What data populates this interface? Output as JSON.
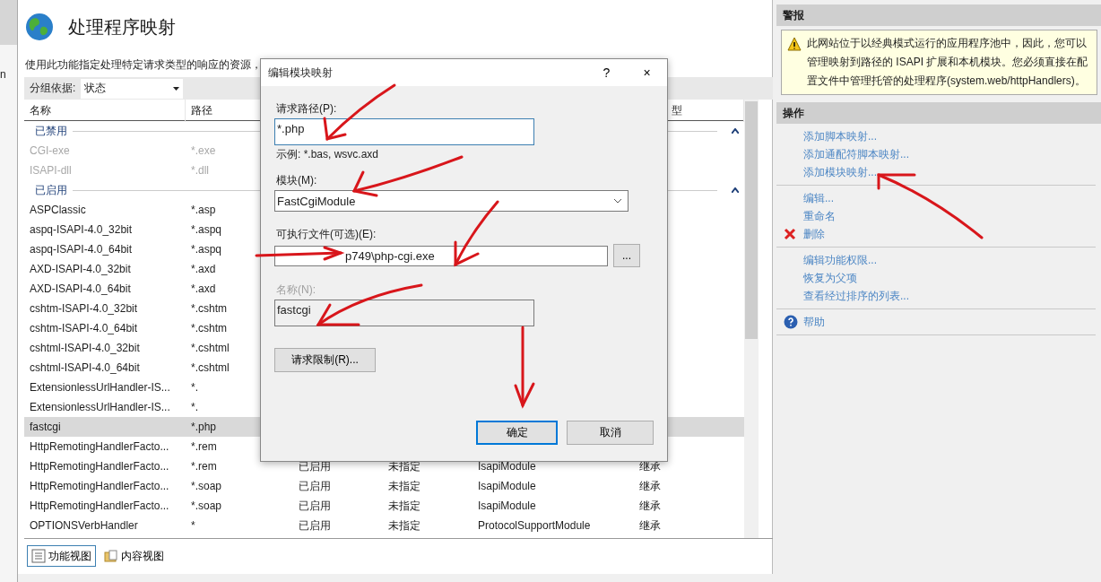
{
  "sidebar_fragment": "n",
  "page": {
    "title": "处理程序映射",
    "description": "使用此功能指定处理特定请求类型的响应的资源，"
  },
  "group_by": {
    "label": "分组依据:",
    "value": "状态"
  },
  "table": {
    "header": {
      "name": "名称",
      "path": "路径",
      "column_6": "型"
    },
    "groups": [
      {
        "label": "已禁用",
        "expanded": true,
        "rows": [
          {
            "name": "CGI-exe",
            "path": "*.exe",
            "disabled": true,
            "selected": false
          },
          {
            "name": "ISAPI-dll",
            "path": "*.dll",
            "disabled": true,
            "selected": false
          }
        ]
      },
      {
        "label": "已启用",
        "expanded": true,
        "rows": [
          {
            "name": "ASPClassic",
            "path": "*.asp",
            "disabled": false,
            "selected": false
          },
          {
            "name": "aspq-ISAPI-4.0_32bit",
            "path": "*.aspq",
            "disabled": false,
            "selected": false
          },
          {
            "name": "aspq-ISAPI-4.0_64bit",
            "path": "*.aspq",
            "disabled": false,
            "selected": false
          },
          {
            "name": "AXD-ISAPI-4.0_32bit",
            "path": "*.axd",
            "disabled": false,
            "selected": false
          },
          {
            "name": "AXD-ISAPI-4.0_64bit",
            "path": "*.axd",
            "disabled": false,
            "selected": false
          },
          {
            "name": "cshtm-ISAPI-4.0_32bit",
            "path": "*.cshtm",
            "disabled": false,
            "selected": false
          },
          {
            "name": "cshtm-ISAPI-4.0_64bit",
            "path": "*.cshtm",
            "disabled": false,
            "selected": false
          },
          {
            "name": "cshtml-ISAPI-4.0_32bit",
            "path": "*.cshtml",
            "disabled": false,
            "selected": false
          },
          {
            "name": "cshtml-ISAPI-4.0_64bit",
            "path": "*.cshtml",
            "disabled": false,
            "selected": false
          },
          {
            "name": "ExtensionlessUrlHandler-IS...",
            "path": "*.",
            "disabled": false,
            "selected": false
          },
          {
            "name": "ExtensionlessUrlHandler-IS...",
            "path": "*.",
            "disabled": false,
            "selected": false
          },
          {
            "name": "fastcgi",
            "path": "*.php",
            "disabled": false,
            "selected": true
          },
          {
            "name": "HttpRemotingHandlerFacto...",
            "path": "*.rem",
            "disabled": false,
            "selected": false
          },
          {
            "name": "HttpRemotingHandlerFacto...",
            "path": "*.rem",
            "column_3": "已启用",
            "column_4": "未指定",
            "column_5": "IsapiModule",
            "column_6": "继承",
            "disabled": false,
            "selected": false
          },
          {
            "name": "HttpRemotingHandlerFacto...",
            "path": "*.soap",
            "column_3": "已启用",
            "column_4": "未指定",
            "column_5": "IsapiModule",
            "column_6": "继承",
            "disabled": false,
            "selected": false
          },
          {
            "name": "HttpRemotingHandlerFacto...",
            "path": "*.soap",
            "column_3": "已启用",
            "column_4": "未指定",
            "column_5": "IsapiModule",
            "column_6": "继承",
            "disabled": false,
            "selected": false
          },
          {
            "name": "OPTIONSVerbHandler",
            "path": "*",
            "column_3": "已启用",
            "column_4": "未指定",
            "column_5": "ProtocolSupportModule",
            "column_6": "继承",
            "disabled": false,
            "selected": false
          }
        ]
      }
    ]
  },
  "view_tabs": [
    {
      "label": "功能视图",
      "selected": true
    },
    {
      "label": "内容视图",
      "selected": false
    }
  ],
  "alerts": {
    "title": "警报",
    "message": "此网站位于以经典模式运行的应用程序池中，因此，您可以管理映射到路径的 ISAPI 扩展和本机模块。您必须直接在配置文件中管理托管的处理程序(system.web/httpHandlers)。"
  },
  "actions": {
    "title": "操作",
    "sections": [
      {
        "items": [
          {
            "label": "添加脚本映射...",
            "kind": "link"
          },
          {
            "label": "添加通配符脚本映射...",
            "kind": "link"
          },
          {
            "label": "添加模块映射...",
            "kind": "link"
          }
        ]
      },
      {
        "items": [
          {
            "label": "编辑...",
            "kind": "link"
          },
          {
            "label": "重命名",
            "kind": "link"
          },
          {
            "label": "删除",
            "kind": "delete"
          }
        ]
      },
      {
        "items": [
          {
            "label": "编辑功能权限...",
            "kind": "link"
          },
          {
            "label": "恢复为父项",
            "kind": "link"
          },
          {
            "label": "查看经过排序的列表...",
            "kind": "link"
          }
        ]
      },
      {
        "items": [
          {
            "label": "帮助",
            "kind": "help"
          }
        ]
      }
    ]
  },
  "dialog": {
    "title": "编辑模块映射",
    "help": "?",
    "close": "×",
    "request_path": {
      "label": "请求路径(P):",
      "value": "*.php",
      "hint": "示例: *.bas, wsvc.axd"
    },
    "module": {
      "label": "模块(M):",
      "value": "FastCgiModule"
    },
    "executable": {
      "label": "可执行文件(可选)(E):",
      "value": "p749\\php-cgi.exe",
      "browse": "..."
    },
    "name": {
      "label": "名称(N):",
      "value": "fastcgi",
      "disabled": true
    },
    "restrictions_button": "请求限制(R)...",
    "ok_button": "确定",
    "cancel_button": "取消"
  }
}
